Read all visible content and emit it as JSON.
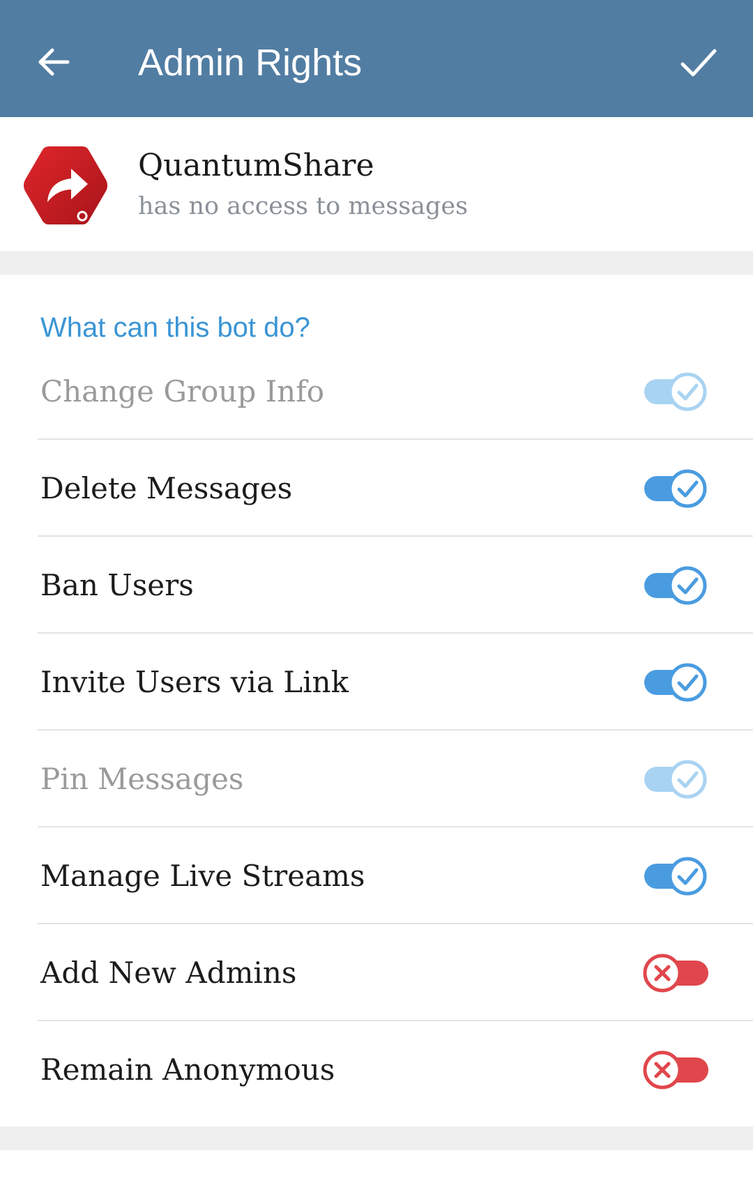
{
  "appbar": {
    "title": "Admin Rights",
    "background_color": "#527DA3",
    "back_icon": "arrow-left-icon",
    "done_icon": "checkmark-icon"
  },
  "bot": {
    "name": "QuantumShare",
    "status": "has no access to messages",
    "avatar_icon": "share-arrow-hexagon-icon",
    "avatar_color": "#C8191E"
  },
  "section": {
    "title": "What can this bot do?",
    "accent_color": "#3A95D5"
  },
  "rights": [
    {
      "label": "Change Group Info",
      "enabled": true,
      "disabled": true
    },
    {
      "label": "Delete Messages",
      "enabled": true,
      "disabled": false
    },
    {
      "label": "Ban Users",
      "enabled": true,
      "disabled": false
    },
    {
      "label": "Invite Users via Link",
      "enabled": true,
      "disabled": false
    },
    {
      "label": "Pin Messages",
      "enabled": true,
      "disabled": true
    },
    {
      "label": "Manage Live Streams",
      "enabled": true,
      "disabled": false
    },
    {
      "label": "Add New Admins",
      "enabled": false,
      "disabled": false
    },
    {
      "label": "Remain Anonymous",
      "enabled": false,
      "disabled": false
    }
  ],
  "colors": {
    "toggle_on": "#4A9CE0",
    "toggle_on_disabled": "#A9D3F2",
    "toggle_off": "#E0474C"
  }
}
